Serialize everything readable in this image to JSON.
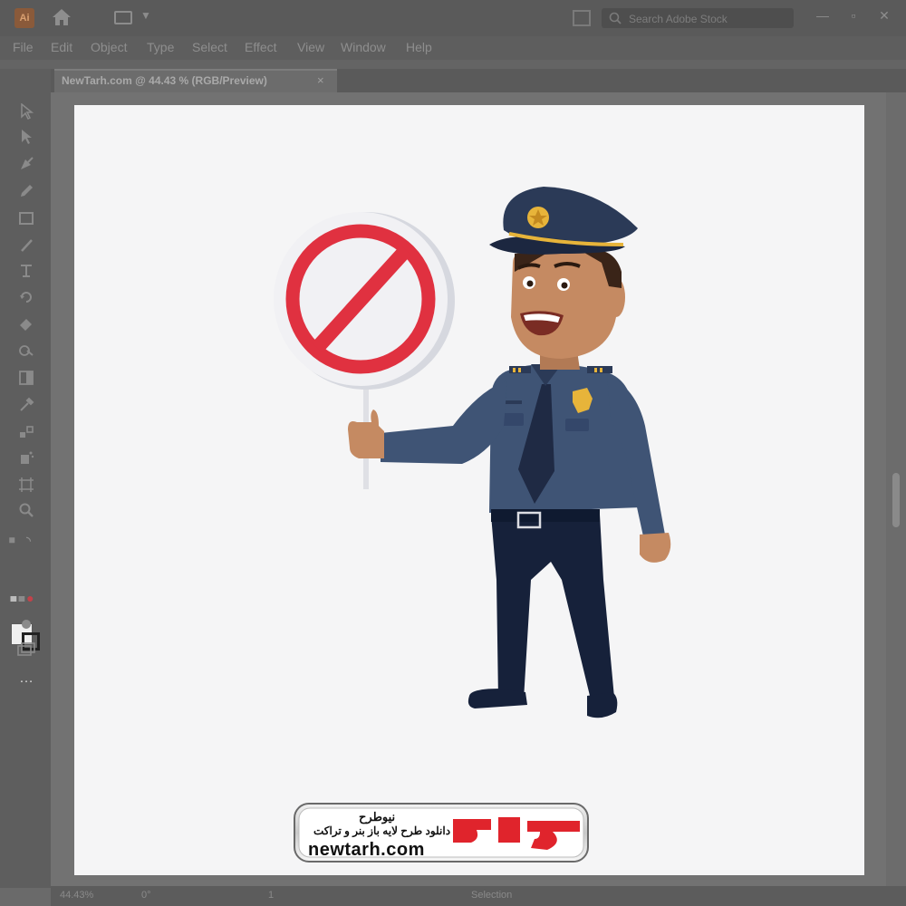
{
  "app": {
    "logo_text": "Ai",
    "search_placeholder": "Search Adobe Stock",
    "window_controls": {
      "minimize": "—",
      "restore": "▫",
      "close": "✕"
    }
  },
  "menu": [
    "File",
    "Edit",
    "Object",
    "Type",
    "Select",
    "Effect",
    "View",
    "Window",
    "Help"
  ],
  "document_tab": {
    "label": "NewTarh.com @ 44.43 % (RGB/Preview)",
    "close": "×"
  },
  "status_bar": {
    "zoom": "44.43%",
    "rotation": "0°",
    "artboard": "1",
    "tool": "Selection"
  },
  "toolbar": {
    "tools": [
      "selection-tool",
      "direct-selection-tool",
      "pen-tool",
      "pencil-tool",
      "rectangle-tool",
      "paintbrush-tool",
      "type-tool",
      "rotate-tool",
      "eraser-tool",
      "shape-builder-tool",
      "gradient-tool",
      "eyedropper-tool",
      "blend-tool",
      "symbol-sprayer-tool",
      "artboard-tool",
      "zoom-tool"
    ],
    "colors": {
      "fill": "#efefef",
      "stroke": "#222222"
    },
    "more": "…"
  },
  "colors": {
    "uniform_dark": "#2b3a57",
    "uniform_shirt": "#3f5475",
    "pants": "#16213a",
    "skin": "#c58a62",
    "sign_red": "#e03140",
    "badge_gold": "#e7b43a",
    "brand_red": "#e0242c"
  },
  "watermark": {
    "brand": "نیوطرح",
    "tagline": "دانلود طرح لایه باز بنر و تراکت",
    "url": "newtarh.com",
    "logo": "نیوطرح"
  }
}
